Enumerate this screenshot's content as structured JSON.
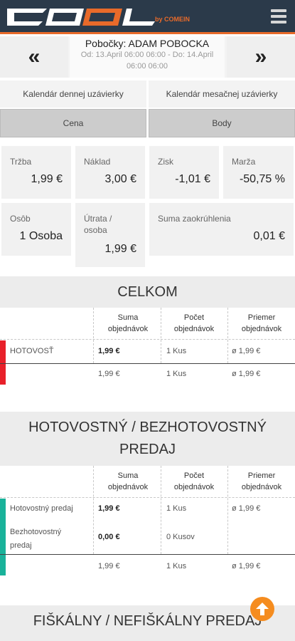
{
  "header": {
    "logo_text": "COOL",
    "logo_by": "by COMEIN",
    "menu_icon": "hamburger-menu-icon",
    "colors": {
      "bar": "#2b3a4a",
      "accent": "#e86a2a"
    }
  },
  "branch": {
    "prev_label": "«",
    "next_label": "»",
    "name": "Pobočky: ADAM POBOCKA",
    "range": "Od: 13.April 06:00 06:00 - Do: 14.April 06:00 06:00"
  },
  "calendar": {
    "daily_label": "Kalendár dennej uzávierky",
    "monthly_label": "Kalendár mesačnej uzávierky"
  },
  "tabs": {
    "price": "Cena",
    "points": "Body"
  },
  "stats": {
    "trzba": {
      "label": "Tržba",
      "value": "1,99 €"
    },
    "naklad": {
      "label": "Náklad",
      "value": "3,00 €"
    },
    "zisk": {
      "label": "Zisk",
      "value": "-1,01 €"
    },
    "marza": {
      "label": "Marža",
      "value": "-50,75 %"
    },
    "osob": {
      "label": "Osôb",
      "value": "1 Osoba"
    },
    "utrata": {
      "label": "Útrata / osoba",
      "value": "1,99 €"
    },
    "zaokruhlenie": {
      "label": "Suma zaokrúhlenia",
      "value": "0,01 €"
    }
  },
  "columns": {
    "sum": "Suma objednávok",
    "count": "Počet objednávok",
    "avg": "Priemer objednávok"
  },
  "celkom": {
    "title": "CELKOM",
    "rows": [
      {
        "name": "HOTOVOSŤ",
        "sum": "1,99 €",
        "count": "1 Kus",
        "avg": "ø 1,99 €",
        "color": "#e8202a"
      }
    ],
    "total": {
      "sum": "1,99 €",
      "count": "1 Kus",
      "avg": "ø 1,99 €"
    }
  },
  "hotovostny": {
    "title": "HOTOVOSTNÝ / BEZHOTOVOSTNÝ PREDAJ",
    "rows": [
      {
        "name": "Hotovostný predaj",
        "sum": "1,99 €",
        "count": "1 Kus",
        "avg": "ø 1,99 €",
        "color": "#19b29a"
      },
      {
        "name": "Bezhotovostný predaj",
        "sum": "0,00 €",
        "count": "0 Kusov",
        "avg": "",
        "color": "#19b29a"
      }
    ],
    "total": {
      "sum": "1,99 €",
      "count": "1 Kus",
      "avg": "ø 1,99 €"
    }
  },
  "fiskalny": {
    "title": "FIŠKÁLNY / NEFIŠKÁLNY PREDAJ"
  },
  "scroll_top_icon": "arrow-up-icon"
}
